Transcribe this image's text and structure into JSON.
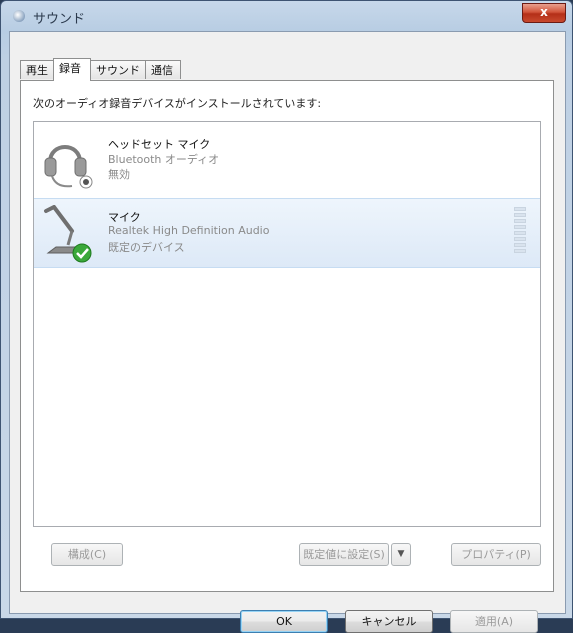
{
  "window": {
    "title": "サウンド",
    "close_label": "x"
  },
  "tabs": [
    {
      "label": "再生",
      "active": false
    },
    {
      "label": "録音",
      "active": true
    },
    {
      "label": "サウンド",
      "active": false
    },
    {
      "label": "通信",
      "active": false
    }
  ],
  "description": "次のオーディオ録音デバイスがインストールされています:",
  "devices": [
    {
      "name": "ヘッドセット マイク",
      "driver": "Bluetooth オーディオ",
      "status": "無効",
      "icon": "headset-icon",
      "selected": false
    },
    {
      "name": "マイク",
      "driver": "Realtek High Definition Audio",
      "status": "既定のデバイス",
      "icon": "microphone-icon",
      "selected": true
    }
  ],
  "buttons": {
    "configure": "構成(C)",
    "set_default": "既定値に設定(S)",
    "properties": "プロパティ(P)",
    "ok": "OK",
    "cancel": "キャンセル",
    "apply": "適用(A)"
  },
  "colors": {
    "accent": "#3c7fb1",
    "selection": "#dde9f7",
    "check_green": "#3aa83a"
  }
}
